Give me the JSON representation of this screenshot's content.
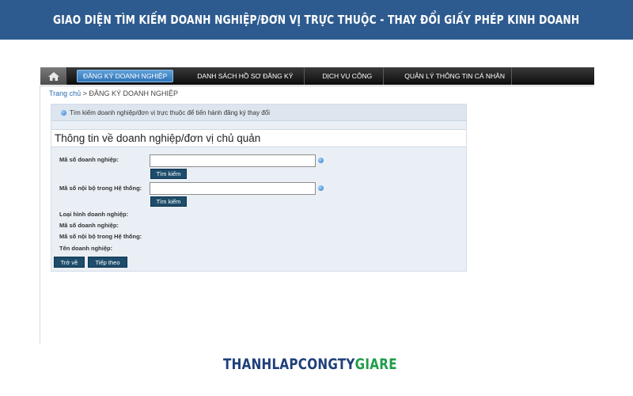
{
  "banner": {
    "title": "GIAO DIỆN TÌM KIẾM DOANH NGHIỆP/ĐƠN VỊ TRỰC THUỘC - THAY ĐỔI GIẤY PHÉP KINH DOANH"
  },
  "nav": {
    "home_icon": "home-icon",
    "items": [
      {
        "label": "ĐĂNG KÝ DOANH NGHIỆP",
        "active": true
      },
      {
        "label": "DANH SÁCH HỒ SƠ ĐĂNG KÝ",
        "active": false
      },
      {
        "label": "DỊCH VỤ CÔNG",
        "active": false
      },
      {
        "label": "QUẢN LÝ THÔNG TIN CÁ NHÂN",
        "active": false
      }
    ]
  },
  "breadcrumb": {
    "home": "Trang chủ",
    "separator": " > ",
    "current": "ĐĂNG KÝ DOANH NGHIỆP"
  },
  "panel": {
    "hint": "Tìm kiếm doanh nghiệp/đơn vị trực thuộc để tiến hành đăng ký thay đổi",
    "section_title": "Thông tin về doanh nghiệp/đơn vị chủ quản",
    "field1": {
      "label": "Mã số doanh nghiệp:",
      "value": "",
      "button": "Tìm kiếm"
    },
    "field2": {
      "label": "Mã số nội bộ trong Hệ thống:",
      "value": "",
      "button": "Tìm kiếm"
    },
    "info_labels": [
      "Loại hình doanh nghiệp:",
      "Mã số doanh nghiệp:",
      "Mã số nội bộ trong Hệ thống:",
      "Tên doanh nghiệp:"
    ],
    "back_button": "Trở về",
    "next_button": "Tiếp theo"
  },
  "logo": {
    "part1": "THANHLAPCONGTY",
    "part2": "GIARE"
  },
  "colors": {
    "banner": "#2e5b8f",
    "navbar": "#111111",
    "nav_active": "#3a82c4",
    "button": "#1e4d6b",
    "logo_blue": "#1f3f7a",
    "logo_green": "#1f9d4a"
  }
}
